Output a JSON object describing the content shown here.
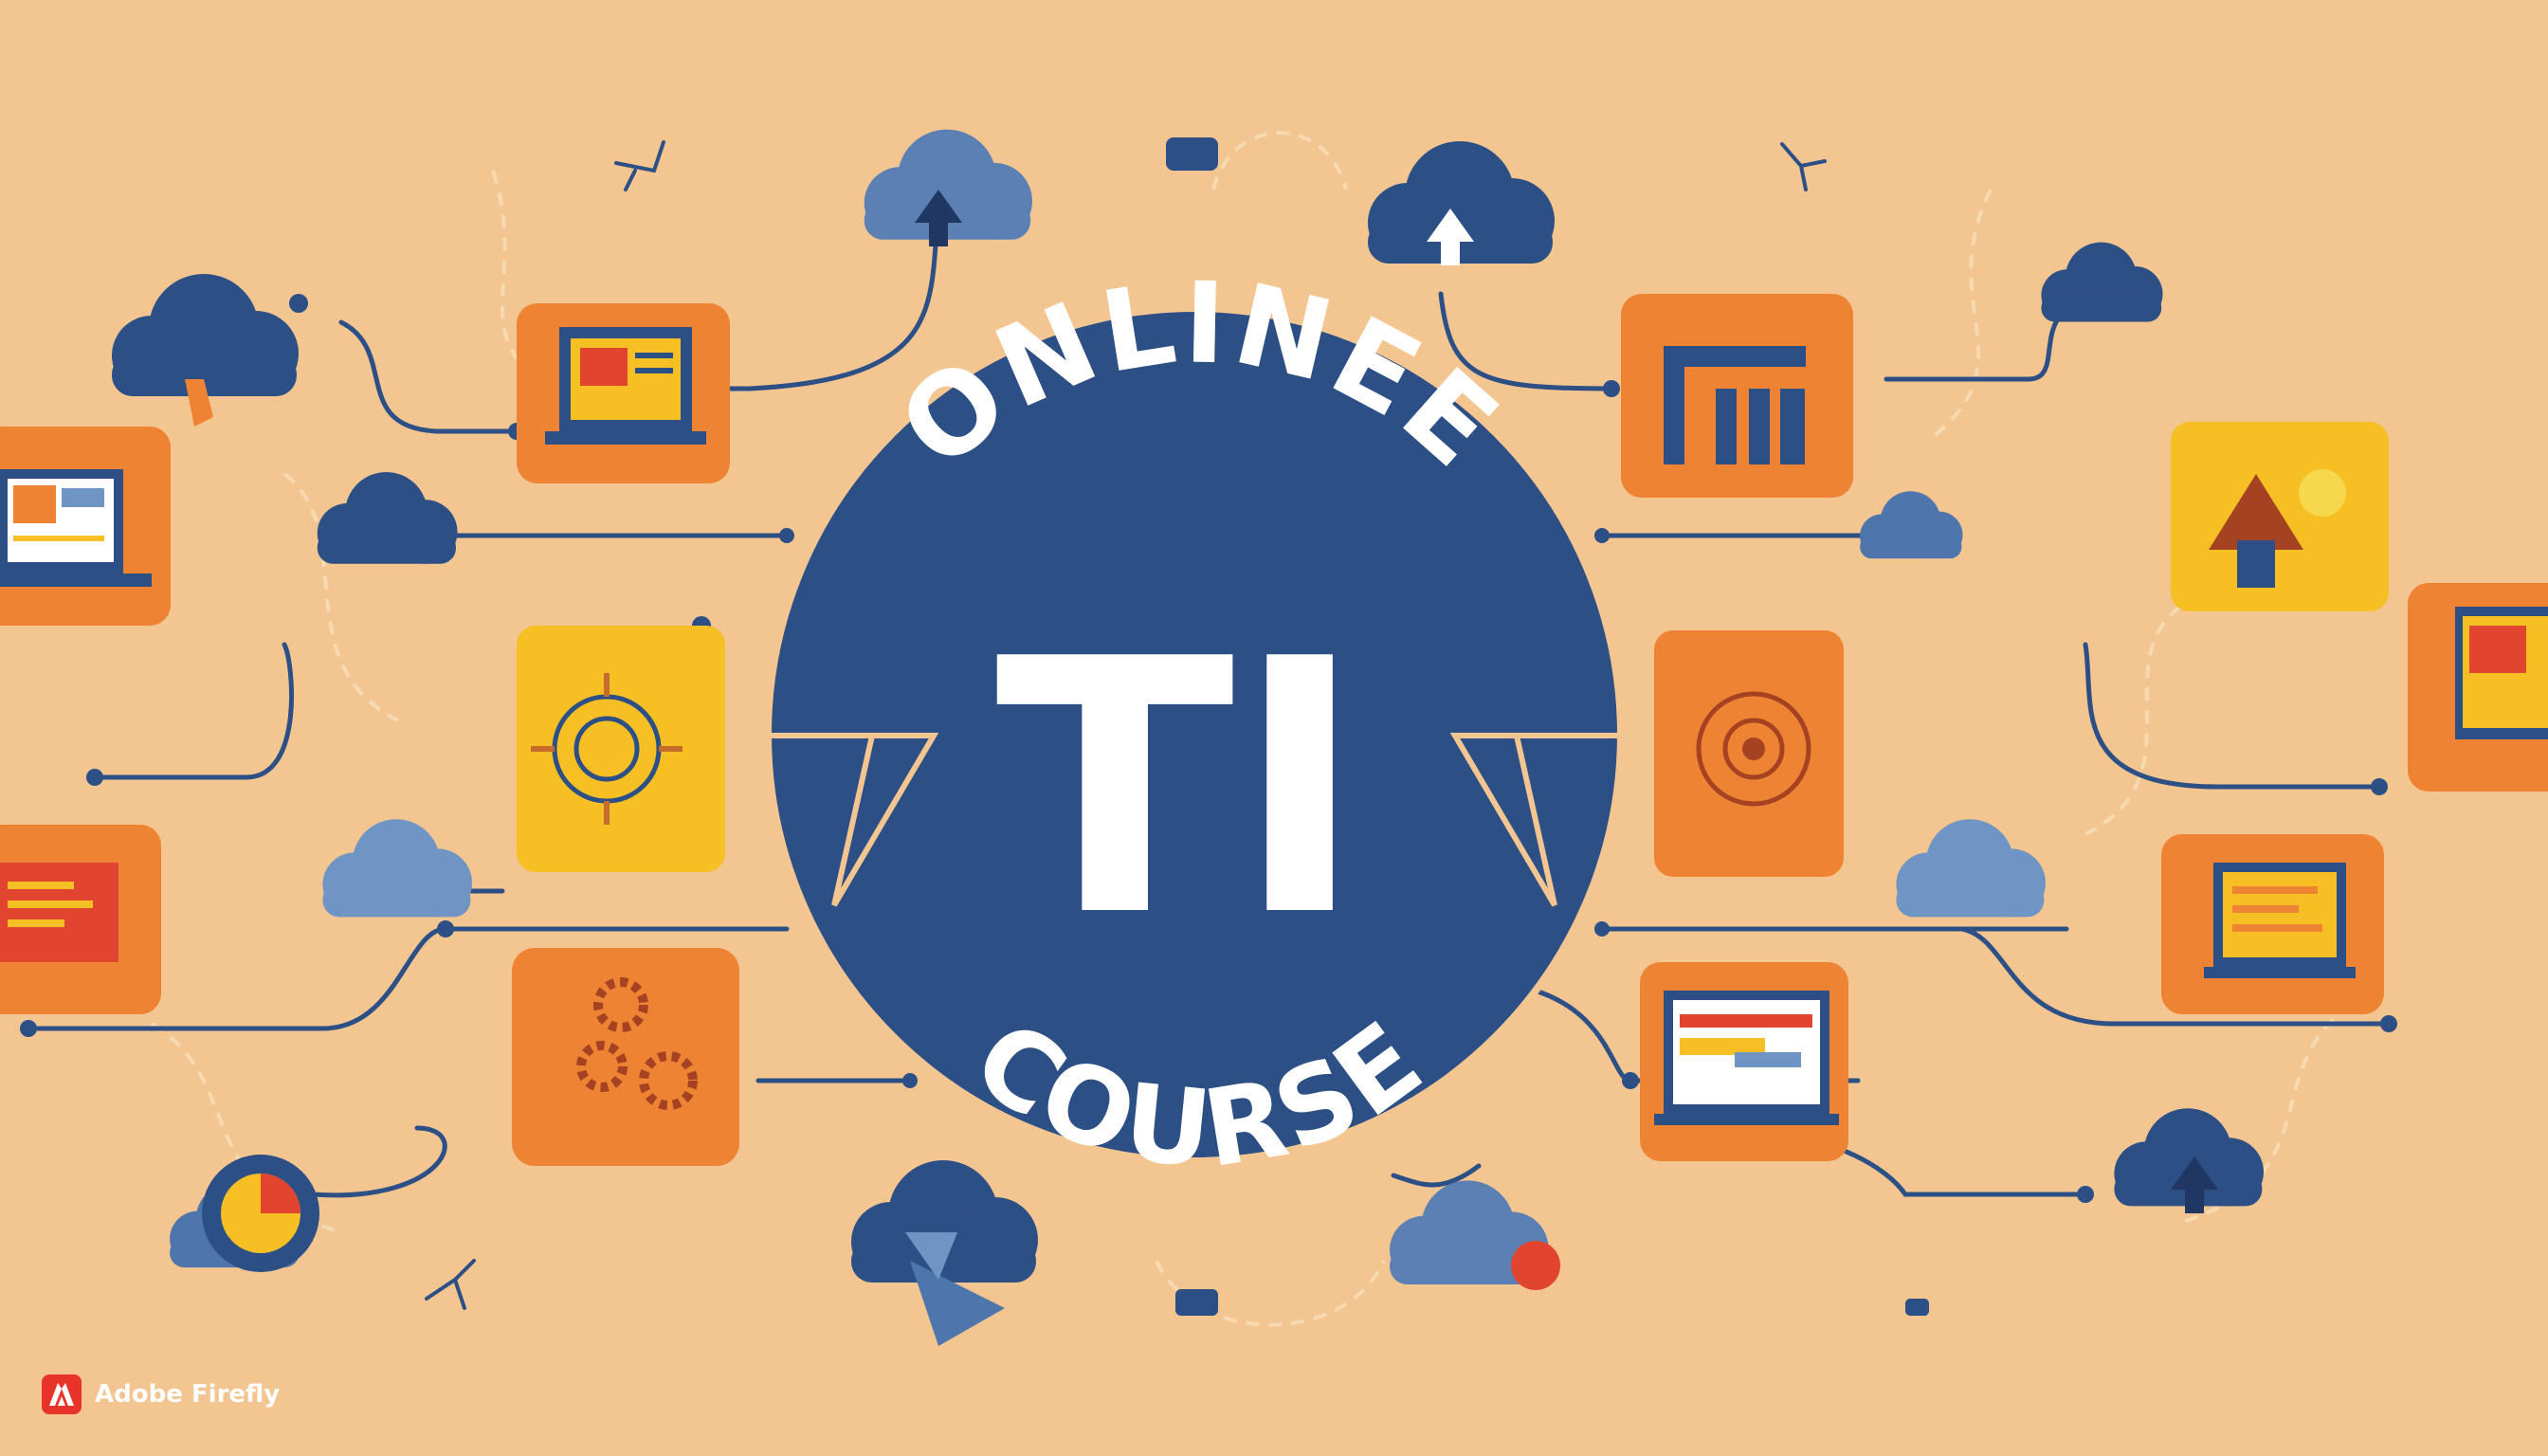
{
  "title": {
    "top": "ONLINEE",
    "center": "TI",
    "bottom": "COURSE"
  },
  "watermark": {
    "label": "Adobe Firefly",
    "icon": "adobe-logo-icon"
  },
  "colors": {
    "background": "#f2c591",
    "navy": "#2c4f85",
    "orange": "#ee8433",
    "yellow": "#f6c024",
    "cloud_light": "#6e95c4",
    "white": "#ffffff"
  }
}
